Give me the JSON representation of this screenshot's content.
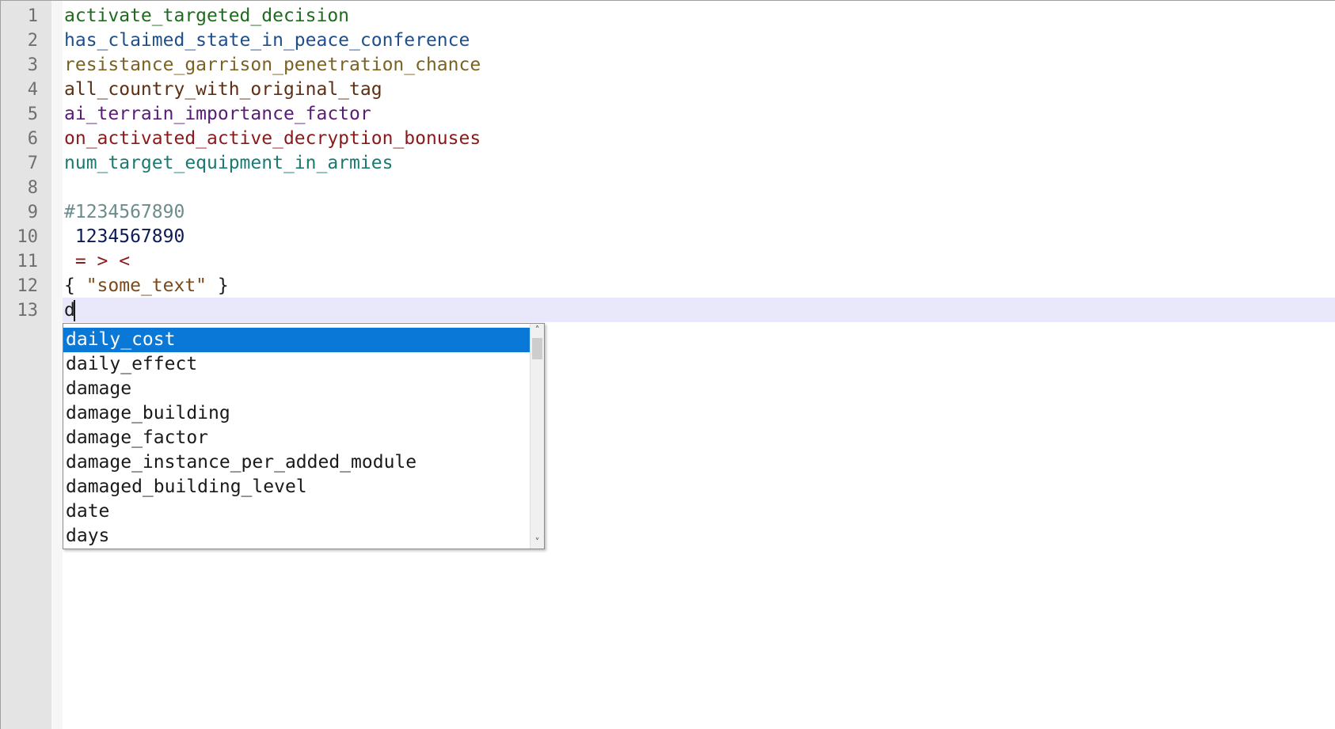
{
  "editor": {
    "line_numbers": [
      "1",
      "2",
      "3",
      "4",
      "5",
      "6",
      "7",
      "8",
      "9",
      "10",
      "11",
      "12",
      "13"
    ],
    "lines": [
      {
        "text": "activate_targeted_decision",
        "color": "#1e6b1e"
      },
      {
        "text": "has_claimed_state_in_peace_conference",
        "color": "#1e4f8a"
      },
      {
        "text": "resistance_garrison_penetration_chance",
        "color": "#7a6222"
      },
      {
        "text": "all_country_with_original_tag",
        "color": "#5e2f12"
      },
      {
        "text": "ai_terrain_importance_factor",
        "color": "#5a1a78"
      },
      {
        "text": "on_activated_active_decryption_bonuses",
        "color": "#8b1a1a"
      },
      {
        "text": "num_target_equipment_in_armies",
        "color": "#1a7a72"
      },
      {
        "text": "",
        "color": "#1a1a1a"
      },
      {
        "text": "#1234567890",
        "color": "#6d8c8c"
      },
      {
        "text": " 1234567890",
        "color": "#0c1a5a"
      },
      {
        "text": " = > <",
        "color": "#8b1a1a"
      },
      {
        "text": "{ \"some_text\" }",
        "color": "#1a1a1a"
      },
      {
        "text": "d",
        "color": "#1a1a1a"
      }
    ]
  },
  "autocomplete": {
    "items": [
      "daily_cost",
      "daily_effect",
      "damage",
      "damage_building",
      "damage_factor",
      "damage_instance_per_added_module",
      "damaged_building_level",
      "date",
      "days"
    ],
    "selected_index": 0,
    "scroll_up_glyph": "˄",
    "scroll_down_glyph": "˅"
  },
  "colors": {
    "string_literal": "#7a4a1a",
    "selection": "#0a78d7",
    "current_line": "#e8e8fa",
    "gutter": "#e4e4e4"
  }
}
